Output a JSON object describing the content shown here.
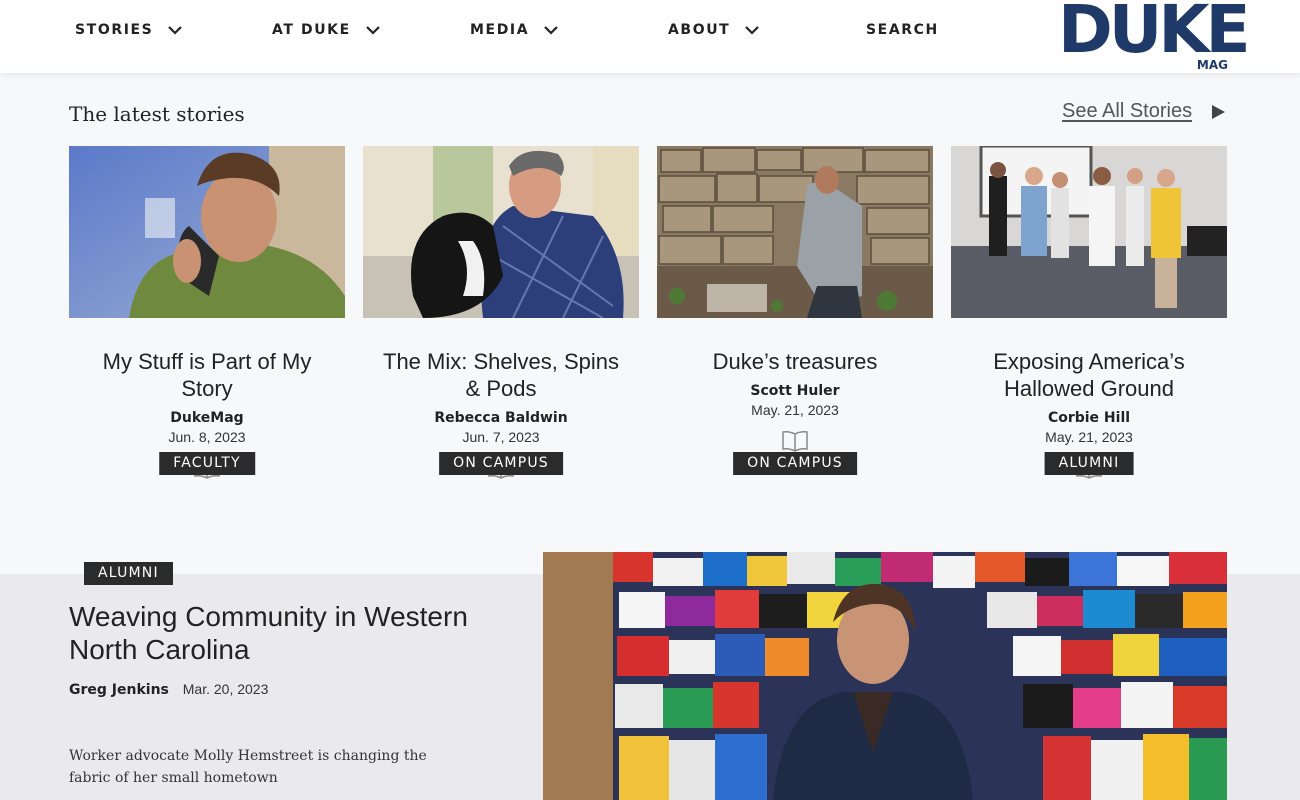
{
  "nav": {
    "items": [
      {
        "label": "STORIES",
        "has_dropdown": true
      },
      {
        "label": "AT DUKE",
        "has_dropdown": true
      },
      {
        "label": "MEDIA",
        "has_dropdown": true
      },
      {
        "label": "ABOUT",
        "has_dropdown": true
      },
      {
        "label": "SEARCH",
        "has_dropdown": false
      }
    ],
    "logo_main": "DUKE",
    "logo_sub": "MAG",
    "brand_color": "#1f3a68"
  },
  "latest": {
    "title": "The latest stories",
    "see_all": "See All Stories",
    "cards": [
      {
        "category": "FACULTY",
        "title": "My Stuff is Part of My Story",
        "author": "DukeMag",
        "date": "Jun. 8, 2023",
        "icon": "book-icon"
      },
      {
        "category": "ON CAMPUS",
        "title": "The Mix: Shelves, Spins & Pods",
        "author": "Rebecca Baldwin",
        "date": "Jun. 7, 2023",
        "icon": "book-icon"
      },
      {
        "category": "ON CAMPUS",
        "title": "Duke’s treasures",
        "author": "Scott Huler",
        "date": "May. 21, 2023",
        "icon": "book-icon"
      },
      {
        "category": "ALUMNI",
        "title": "Exposing America’s Hallowed Ground",
        "author": "Corbie Hill",
        "date": "May. 21, 2023",
        "icon": "book-icon"
      }
    ]
  },
  "feature": {
    "category": "ALUMNI",
    "title": "Weaving Community in Western North Carolina",
    "author": "Greg Jenkins",
    "date": "Mar. 20, 2023",
    "description": "Worker advocate Molly Hemstreet is changing the fabric of her small hometown"
  }
}
